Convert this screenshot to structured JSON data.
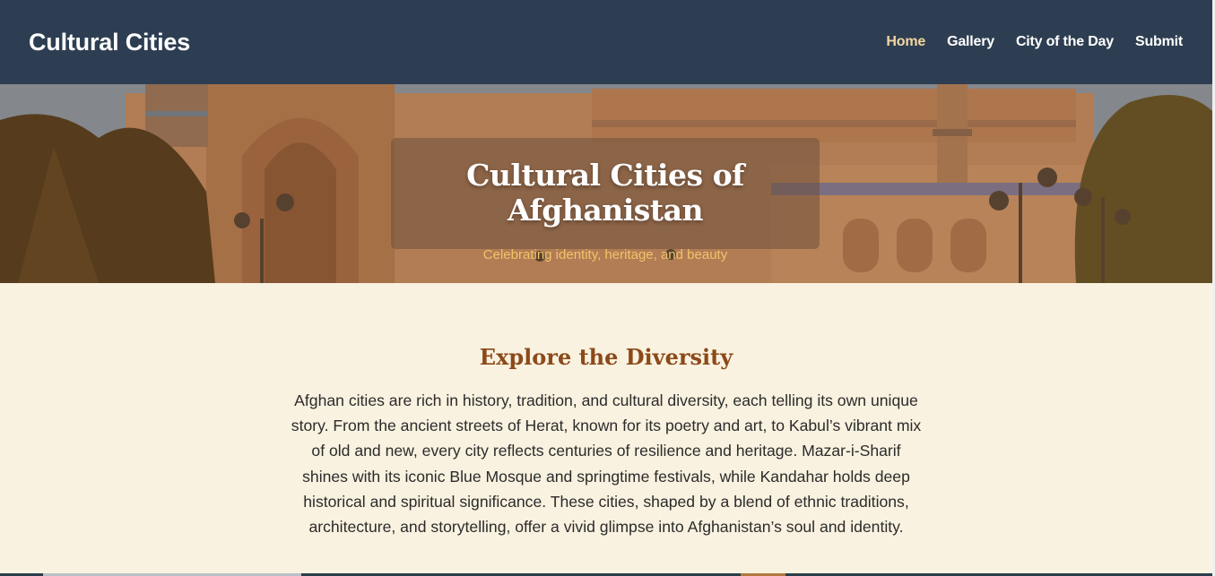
{
  "header": {
    "brand": "Cultural Cities",
    "nav": [
      {
        "label": "Home",
        "active": true
      },
      {
        "label": "Gallery",
        "active": false
      },
      {
        "label": "City of the Day",
        "active": false
      },
      {
        "label": "Submit",
        "active": false
      }
    ]
  },
  "hero": {
    "title": "Cultural Cities of Afghanistan",
    "subtitle": "Celebrating identity, heritage, and beauty"
  },
  "main": {
    "heading": "Explore the Diversity",
    "paragraph": "Afghan cities are rich in history, tradition, and cultural diversity, each telling its own unique story. From the ancient streets of Herat, known for its poetry and art, to Kabul’s vibrant mix of old and new, every city reflects centuries of resilience and heritage. Mazar-i-Sharif shines with its iconic Blue Mosque and springtime festivals, while Kandahar holds deep historical and spiritual significance. These cities, shaped by a blend of ethnic traditions, architecture, and storytelling, offer a vivid glimpse into Afghanistan’s soul and identity."
  },
  "colors": {
    "header_bg": "#2e3e52",
    "nav_active": "#f2d6a3",
    "page_bg": "#faf2e0",
    "heading": "#8b4a1a",
    "hero_subtitle": "#f0c46a"
  }
}
